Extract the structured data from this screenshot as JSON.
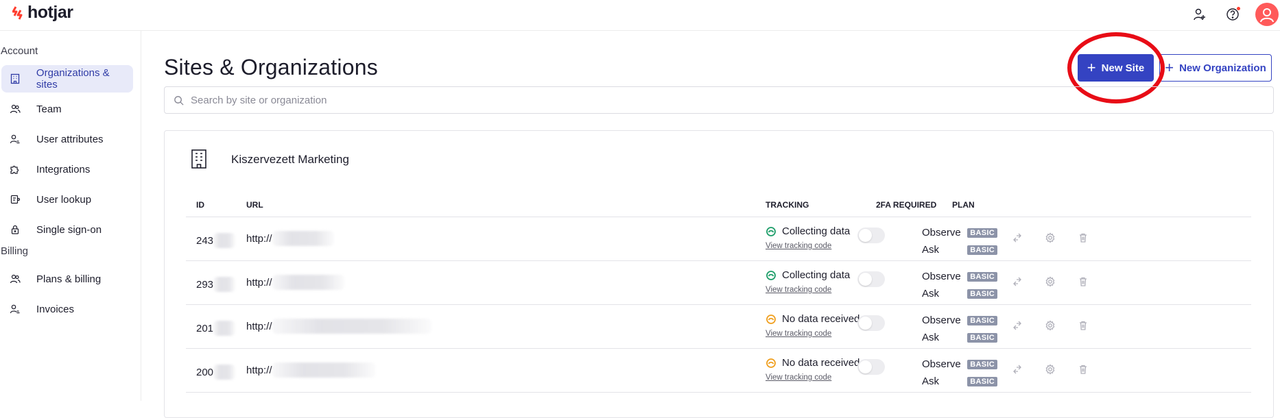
{
  "brand": {
    "name": "hotjar",
    "accent": "#ff3d2e"
  },
  "topbar": {
    "icons": [
      "add-user-icon",
      "help-icon",
      "avatar-icon"
    ]
  },
  "sidebar": {
    "sections": [
      {
        "title": "Account",
        "items": [
          {
            "label": "Organizations & sites",
            "icon": "building-icon",
            "active": true
          },
          {
            "label": "Team",
            "icon": "team-icon"
          },
          {
            "label": "User attributes",
            "icon": "user-attributes-icon"
          },
          {
            "label": "Integrations",
            "icon": "puzzle-icon"
          },
          {
            "label": "User lookup",
            "icon": "user-lookup-icon"
          },
          {
            "label": "Single sign-on",
            "icon": "lock-icon"
          }
        ]
      },
      {
        "title": "Billing",
        "items": [
          {
            "label": "Plans & billing",
            "icon": "plans-icon"
          },
          {
            "label": "Invoices",
            "icon": "invoices-icon"
          }
        ]
      }
    ]
  },
  "main": {
    "title": "Sites & Organizations",
    "new_site_label": "New Site",
    "new_org_label": "New Organization",
    "search_placeholder": "Search by site or organization",
    "org": {
      "name": "Kiszervezett Marketing",
      "columns": {
        "id": "ID",
        "url": "URL",
        "tracking": "TRACKING",
        "twofa": "2FA REQUIRED",
        "plan": "PLAN"
      },
      "rows": [
        {
          "id": "243",
          "url": "http://",
          "tracking": "Collecting data",
          "status": "collecting",
          "link": "View tracking code",
          "plan_1": "Observe",
          "plan_2": "Ask",
          "badge": "BASIC"
        },
        {
          "id": "293",
          "url": "http://",
          "tracking": "Collecting data",
          "status": "collecting",
          "link": "View tracking code",
          "plan_1": "Observe",
          "plan_2": "Ask",
          "badge": "BASIC"
        },
        {
          "id": "201",
          "url": "http://",
          "tracking": "No data received",
          "status": "none",
          "link": "View tracking code",
          "plan_1": "Observe",
          "plan_2": "Ask",
          "badge": "BASIC"
        },
        {
          "id": "200",
          "url": "http://",
          "tracking": "No data received",
          "status": "none",
          "link": "View tracking code",
          "plan_1": "Observe",
          "plan_2": "Ask",
          "badge": "BASIC"
        }
      ]
    }
  },
  "colors": {
    "primary": "#3443c2",
    "collecting": "#1e9e6a",
    "no_data": "#f0a020",
    "annotation": "#e80c16"
  }
}
